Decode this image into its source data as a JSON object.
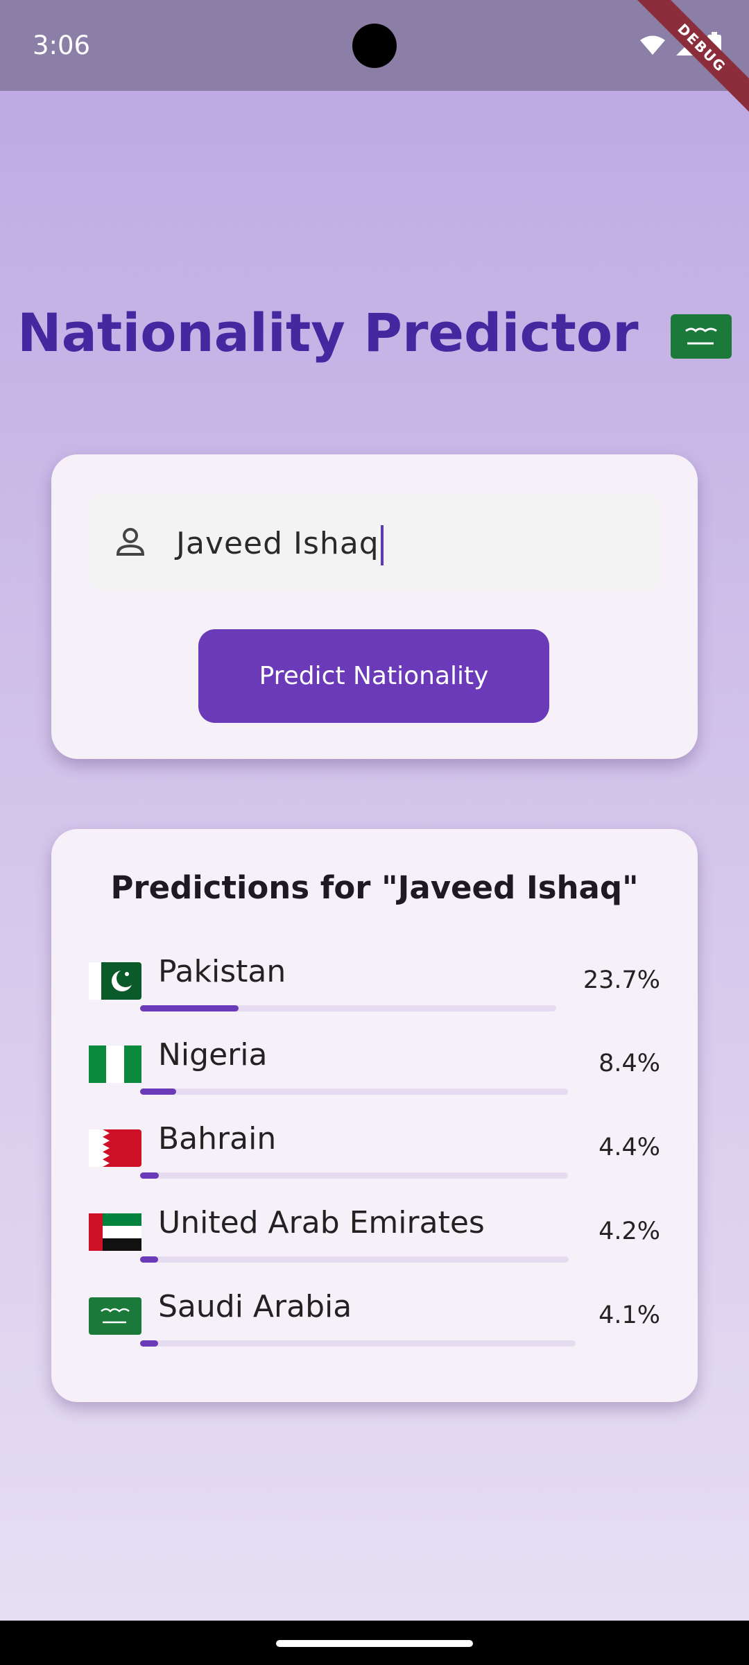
{
  "status_bar": {
    "time": "3:06",
    "debug_label": "DEBUG"
  },
  "app": {
    "title": "Nationality Predictor"
  },
  "input": {
    "name_value": "Javeed Ishaq",
    "button_label": "Predict Nationality"
  },
  "results": {
    "title": "Predictions for \"Javeed Ishaq\"",
    "items": [
      {
        "country": "Pakistan",
        "percent": "23.7%",
        "probability": 0.237
      },
      {
        "country": "Nigeria",
        "percent": "8.4%",
        "probability": 0.084
      },
      {
        "country": "Bahrain",
        "percent": "4.4%",
        "probability": 0.044
      },
      {
        "country": "United Arab Emirates",
        "percent": "4.2%",
        "probability": 0.042
      },
      {
        "country": "Saudi Arabia",
        "percent": "4.1%",
        "probability": 0.041
      }
    ]
  },
  "colors": {
    "accent": "#6a3ab8",
    "title": "#4527a0",
    "bar_track": "#e6dcf2"
  }
}
